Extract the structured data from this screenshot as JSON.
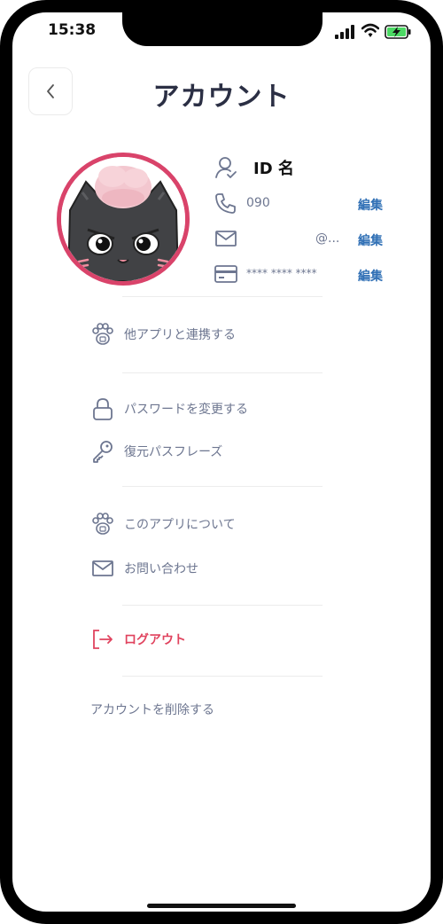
{
  "status_bar": {
    "time": "15:38"
  },
  "header": {
    "title": "アカウント"
  },
  "profile": {
    "id_name": "ID 名",
    "phone": "090",
    "email": "@...",
    "card": "**** **** ****",
    "edit_label": "編集"
  },
  "menu": {
    "link_apps": "他アプリと連携する",
    "change_password": "パスワードを変更する",
    "recovery_phrase": "復元パスフレーズ",
    "about_app": "このアプリについて",
    "contact": "お問い合わせ",
    "logout": "ログアウト",
    "delete_account": "アカウントを削除する"
  },
  "colors": {
    "accent": "#d9436a",
    "edit": "#2f6fb5",
    "logout": "#e0435e",
    "icon": "#6d7690"
  }
}
